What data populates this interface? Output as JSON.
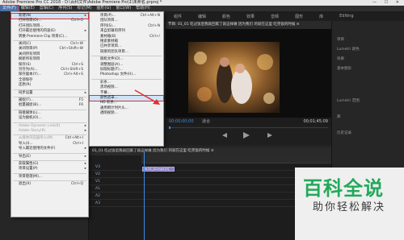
{
  "window": {
    "title": "Adobe Premiere Pro CC 2018 - D:\\百科文件\\Adobe Premiere Pro\\1\\未命名.prproj *",
    "controls": "— ☐ ✕"
  },
  "menubar": [
    "文件(F)",
    "编辑(E)",
    "剪辑(C)",
    "序列(S)",
    "标记(M)",
    "图形(G)",
    "窗口(W)",
    "帮助(H)"
  ],
  "workspace_tabs": [
    "组件",
    "编辑",
    "颜色",
    "效果",
    "音频",
    "图形",
    "库",
    "Editing"
  ],
  "file_menu": [
    {
      "label": "新建(N)",
      "arrow": "▸",
      "highlighted": true
    },
    {
      "label": "打开项目(O)...",
      "shortcut": "Ctrl+O"
    },
    {
      "label": "打开团队项目..."
    },
    {
      "label": "打开最近使用的内容(E)",
      "arrow": "▸"
    },
    {
      "label": "转换 Premiere Clip 项目(C)..."
    },
    {
      "sep": true
    },
    {
      "label": "关闭(C)",
      "shortcut": "Ctrl+W"
    },
    {
      "label": "关闭项目(P)",
      "shortcut": "Ctrl+Shift+W"
    },
    {
      "label": "关闭所有项目"
    },
    {
      "label": "刷新所有项目"
    },
    {
      "label": "保存(S)",
      "shortcut": "Ctrl+S"
    },
    {
      "label": "另存为(A)...",
      "shortcut": "Ctrl+Shift+S"
    },
    {
      "label": "保存副本(Y)...",
      "shortcut": "Ctrl+Alt+S"
    },
    {
      "label": "全部保存"
    },
    {
      "label": "还原(R)"
    },
    {
      "sep": true
    },
    {
      "label": "同步设置",
      "arrow": "▸"
    },
    {
      "sep": true
    },
    {
      "label": "捕捉(T)...",
      "shortcut": "F5"
    },
    {
      "label": "批量捕捉(B)...",
      "shortcut": "F6"
    },
    {
      "sep": true
    },
    {
      "label": "链接媒体(L)..."
    },
    {
      "label": "设为脱机(O)..."
    },
    {
      "sep": true
    },
    {
      "label": "Adobe Dynamic Link(K)",
      "arrow": "▸",
      "disabled": true
    },
    {
      "label": "Adobe Story(R)",
      "arrow": "▸",
      "disabled": true
    },
    {
      "sep": true
    },
    {
      "label": "从媒体浏览器导入(M)",
      "shortcut": "Ctrl+Alt+I",
      "disabled": true
    },
    {
      "label": "导入(I)...",
      "shortcut": "Ctrl+I"
    },
    {
      "label": "导入最近使用的文件(F)",
      "arrow": "▸"
    },
    {
      "sep": true
    },
    {
      "label": "导出(E)",
      "arrow": "▸"
    },
    {
      "sep": true
    },
    {
      "label": "获取属性(G)",
      "arrow": "▸"
    },
    {
      "label": "项目设置(P)",
      "arrow": "▸"
    },
    {
      "sep": true
    },
    {
      "label": "项目管理(M)..."
    },
    {
      "sep": true
    },
    {
      "label": "退出(X)",
      "shortcut": "Ctrl+Q"
    }
  ],
  "submenu": [
    {
      "label": "项目(P)...",
      "shortcut": "Ctrl+Alt+N"
    },
    {
      "label": "团队项目..."
    },
    {
      "label": "序列(S)...",
      "shortcut": "Ctrl+N"
    },
    {
      "label": "来自剪辑的序列"
    },
    {
      "label": "素材箱(B)",
      "shortcut": "Ctrl+/"
    },
    {
      "label": "搜索素材箱"
    },
    {
      "label": "已共享项目..."
    },
    {
      "label": "链接的团队项目..."
    },
    {
      "sep": true
    },
    {
      "label": "脱机文件(O)..."
    },
    {
      "label": "调整图层(A)..."
    },
    {
      "label": "旧版标题(T)..."
    },
    {
      "label": "Photoshop 文件(H)..."
    },
    {
      "sep": true
    },
    {
      "label": "彩条..."
    },
    {
      "label": "黑场视频..."
    },
    {
      "label": "字幕..."
    },
    {
      "label": "颜色遮罩...",
      "highlighted": true
    },
    {
      "label": "HD 彩条..."
    },
    {
      "label": "通用倒计时片头..."
    },
    {
      "label": "透明视频..."
    }
  ],
  "program_monitor": {
    "title": "节目: 01_01 吃过饭后我就回家了就这样做 因为我们 的就在这里 吃完饭的时候 ≡",
    "timecode_left": "00;00;00;00",
    "fit": "适合",
    "timecode_right": "00;01;45;09"
  },
  "timeline": {
    "title": "01_01 吃过饭后我就回家了就这样做 因为我们 的就在这里 吃完饭的时候 ≡",
    "tracks": [
      "V3",
      "V2",
      "V1",
      "A1",
      "A2",
      "A3"
    ],
    "clip_label": "fx 01_01.mp4 [V]"
  },
  "right_panel": [
    "项目",
    "Lumetri 颜色",
    "效果",
    "基本图形",
    "Lumetri 范围",
    "库",
    "历史记录"
  ],
  "watermark": {
    "title": "百科全说",
    "subtitle": "助你轻松解决"
  },
  "colors": {
    "highlight_red": "#e03030",
    "timecode_blue": "#3d8ee6",
    "clip_purple": "#8b7fc6",
    "watermark_green": "#22a95a"
  }
}
